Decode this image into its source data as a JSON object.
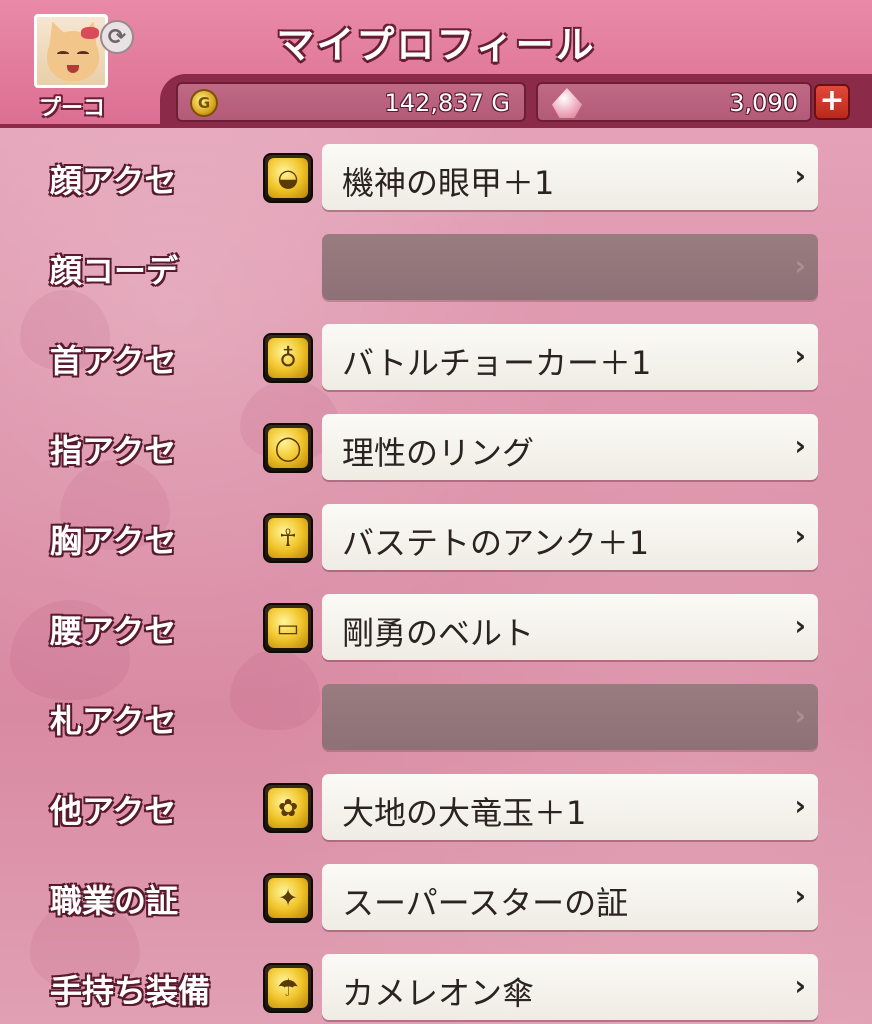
{
  "header": {
    "title": "マイプロフィール",
    "character_name": "プーコ",
    "gold": "142,837 G",
    "gems": "3,090",
    "plus_label": "+"
  },
  "slots": [
    {
      "label": "顔アクセ",
      "item": "機神の眼甲＋1",
      "icon": "mask-icon",
      "glyph": "◒"
    },
    {
      "label": "顔コーデ",
      "item": "",
      "icon": "",
      "glyph": ""
    },
    {
      "label": "首アクセ",
      "item": "バトルチョーカー＋1",
      "icon": "necklace-icon",
      "glyph": "♁"
    },
    {
      "label": "指アクセ",
      "item": "理性のリング",
      "icon": "ring-icon",
      "glyph": "◯"
    },
    {
      "label": "胸アクセ",
      "item": "バステトのアンク＋1",
      "icon": "brooch-icon",
      "glyph": "☥"
    },
    {
      "label": "腰アクセ",
      "item": "剛勇のベルト",
      "icon": "belt-icon",
      "glyph": "▭"
    },
    {
      "label": "札アクセ",
      "item": "",
      "icon": "",
      "glyph": ""
    },
    {
      "label": "他アクセ",
      "item": "大地の大竜玉＋1",
      "icon": "ribbon-icon",
      "glyph": "✿"
    },
    {
      "label": "職業の証",
      "item": "スーパースターの証",
      "icon": "badge-icon",
      "glyph": "✦"
    },
    {
      "label": "手持ち装備",
      "item": "カメレオン傘",
      "icon": "umbrella-icon",
      "glyph": "☂"
    }
  ],
  "chevron": "›",
  "colors": {
    "header_bg": "#dc6f93",
    "header_border": "#8c2a49",
    "background": "#dd93ab",
    "button_bg": "#f6f4ee",
    "button_empty_bg": "#937679",
    "icon_gold": "#f1c42a"
  }
}
